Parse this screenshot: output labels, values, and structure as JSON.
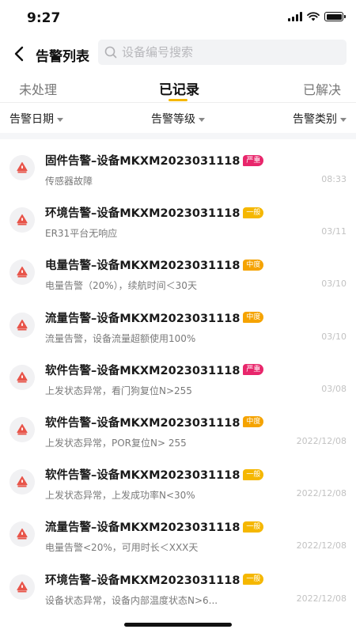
{
  "status_bar": {
    "time": "9:27"
  },
  "header": {
    "title": "告警列表",
    "search_placeholder": "设备编号搜索"
  },
  "tabs": [
    {
      "label": "未处理"
    },
    {
      "label": "已记录"
    },
    {
      "label": "已解决"
    }
  ],
  "active_tab": "已记录",
  "filters": [
    {
      "label": "告警日期"
    },
    {
      "label": "告警等级"
    },
    {
      "label": "告警类别"
    }
  ],
  "colors": {
    "accent": "#f5b700",
    "severe": "#e8266b",
    "normal": "#f5b700",
    "medium": "#f5a300",
    "icon_red": "#e8554a"
  },
  "alarms": [
    {
      "title": "固件告警–设备MKXM2023031118",
      "level": "严重",
      "level_type": "severe",
      "desc": "传感器故障",
      "time": "08:33"
    },
    {
      "title": "环境告警–设备MKXM2023031118",
      "level": "一般",
      "level_type": "normal",
      "desc": "ER31平台无响应",
      "time": "03/11"
    },
    {
      "title": "电量告警–设备MKXM2023031118",
      "level": "中度",
      "level_type": "medium",
      "desc": "电量告警（20%），续航时间＜30天",
      "time": "03/10"
    },
    {
      "title": "流量告警–设备MKXM2023031118",
      "level": "中度",
      "level_type": "medium",
      "desc": "流量告警，设备流量超额使用100%",
      "time": "03/10"
    },
    {
      "title": "软件告警–设备MKXM2023031118",
      "level": "严重",
      "level_type": "severe",
      "desc": "上发状态异常，看门狗复位N>255",
      "time": "03/08"
    },
    {
      "title": "软件告警–设备MKXM2023031118",
      "level": "中度",
      "level_type": "medium",
      "desc": "上发状态异常，POR复位N> 255",
      "time": "2022/12/08"
    },
    {
      "title": "软件告警–设备MKXM2023031118",
      "level": "一般",
      "level_type": "normal",
      "desc": "上发状态异常，上发成功率N<30%",
      "time": "2022/12/08"
    },
    {
      "title": "流量告警–设备MKXM2023031118",
      "level": "一般",
      "level_type": "normal",
      "desc": "电量告警<20%，可用时长＜XXX天",
      "time": "2022/12/08"
    },
    {
      "title": "环境告警–设备MKXM2023031118",
      "level": "一般",
      "level_type": "normal",
      "desc": "设备状态异常，设备内部温度状态N>6...",
      "time": "2022/12/08"
    }
  ]
}
